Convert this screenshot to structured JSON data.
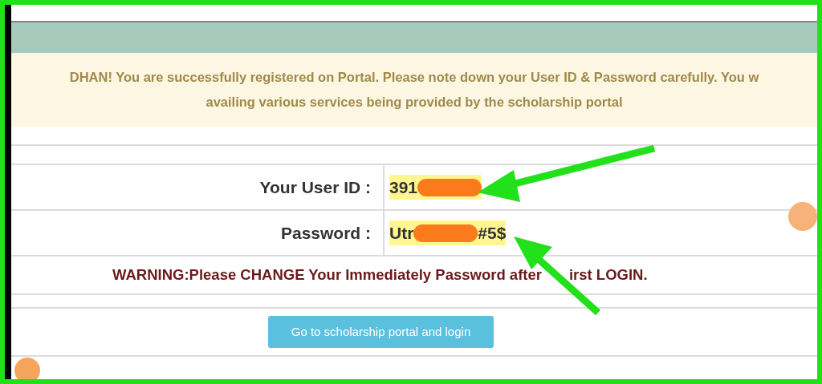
{
  "notice": {
    "lines": [
      "DHAN! You are successfully registered on Portal. Please note down your User ID & Password carefully. You w",
      "availing various services being provided by the scholarship portal"
    ]
  },
  "credentials": [
    {
      "label": "Your User ID :",
      "value_start": "391"
    },
    {
      "label": "Password :",
      "value_start": "Utr",
      "value_end": "#5$"
    }
  ],
  "warning": {
    "before_arrow": "WARNING:Please CHANGE Your Immediately Password after",
    "after_arrow": "irst LOGIN."
  },
  "button": "Go to scholarship portal and login"
}
